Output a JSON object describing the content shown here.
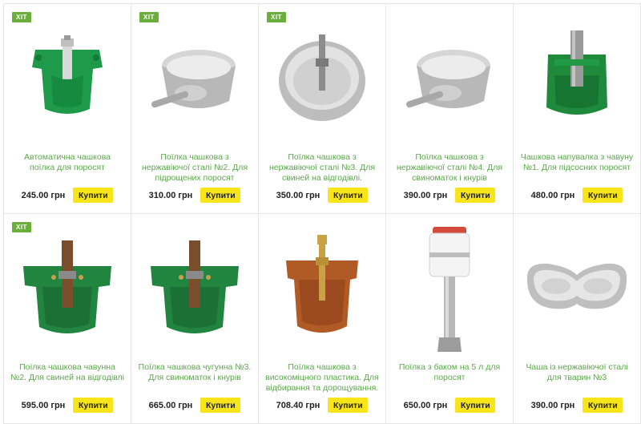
{
  "products": [
    {
      "badge": "ХІТ",
      "title": "Автоматична чашкова поїлка для поросят",
      "price": "245.00 грн",
      "buy_label": "Купити",
      "icon": "green-pig-waterer-icon"
    },
    {
      "badge": "ХІТ",
      "title": "Поїлка чашкова з нержавіючої сталі №2. Для підрощених поросят",
      "price": "310.00 грн",
      "buy_label": "Купити",
      "icon": "steel-bowl-icon"
    },
    {
      "badge": "ХІТ",
      "title": "Поїлка чашкова з нержавіючої сталі №3. Для свиней на відгодівлі.",
      "price": "350.00 грн",
      "buy_label": "Купити",
      "icon": "steel-round-bowl-icon"
    },
    {
      "badge": "",
      "title": "Поїлка чашкова з нержавіючої сталі №4. Для свиноматок і кнурів",
      "price": "390.00 грн",
      "buy_label": "Купити",
      "icon": "steel-bowl-icon"
    },
    {
      "badge": "",
      "title": "Чашкова напувалка з чавуну №1. Для підсосних поросят",
      "price": "480.00 грн",
      "buy_label": "Купити",
      "icon": "cast-iron-waterer-icon"
    },
    {
      "badge": "ХІТ",
      "title": "Поїлка чашкова чавунна №2. Для свиней на відгодівлі",
      "price": "595.00 грн",
      "buy_label": "Купити",
      "icon": "cast-iron-bowl-icon"
    },
    {
      "badge": "",
      "title": "Поїлка чашкова чугунна №3. Для свиноматок і кнурів",
      "price": "665.00 грн",
      "buy_label": "Купити",
      "icon": "cast-iron-bowl-icon"
    },
    {
      "badge": "",
      "title": "Поїлка чашкова з високомiцного пластика. Для відбирання та дорощування.",
      "price": "708.40 грн",
      "buy_label": "Купити",
      "icon": "plastic-bowl-icon"
    },
    {
      "badge": "",
      "title": "Поїлка з баком на 5 л для поросят",
      "price": "650.00 грн",
      "buy_label": "Купити",
      "icon": "tank-waterer-icon"
    },
    {
      "badge": "",
      "title": "Чаша із нержавіючої сталі для тварин №3",
      "price": "390.00 грн",
      "buy_label": "Купити",
      "icon": "steel-dish-icon"
    }
  ],
  "colors": {
    "badge": "#6cae3c",
    "title": "#5aa84a",
    "button": "#f7e51a"
  }
}
